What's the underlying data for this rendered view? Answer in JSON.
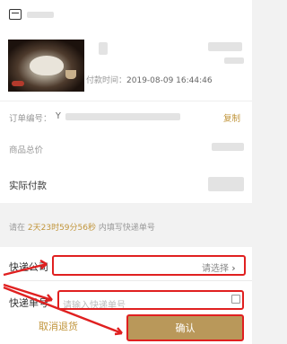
{
  "order": {
    "time_label": "付款时间：",
    "time_value": "2019-08-09 16:44:46",
    "number_label": "订单编号：",
    "number_prefix": "Y",
    "copy_label": "复制"
  },
  "summary": {
    "total_label": "商品总价",
    "paid_label": "实际付款"
  },
  "notice": {
    "prefix": "请在",
    "countdown": "2天23时59分56秒",
    "suffix": "内填写快递单号"
  },
  "form": {
    "company_label": "快递公司",
    "company_value": "请选择",
    "tracking_label": "快递单号",
    "tracking_placeholder": "请输入快递单号"
  },
  "actions": {
    "cancel_label": "取消退货",
    "confirm_label": "确认"
  },
  "colors": {
    "accent_gold": "#c1953b",
    "confirm_bg": "#b9985a",
    "annotation_red": "#e02020"
  }
}
